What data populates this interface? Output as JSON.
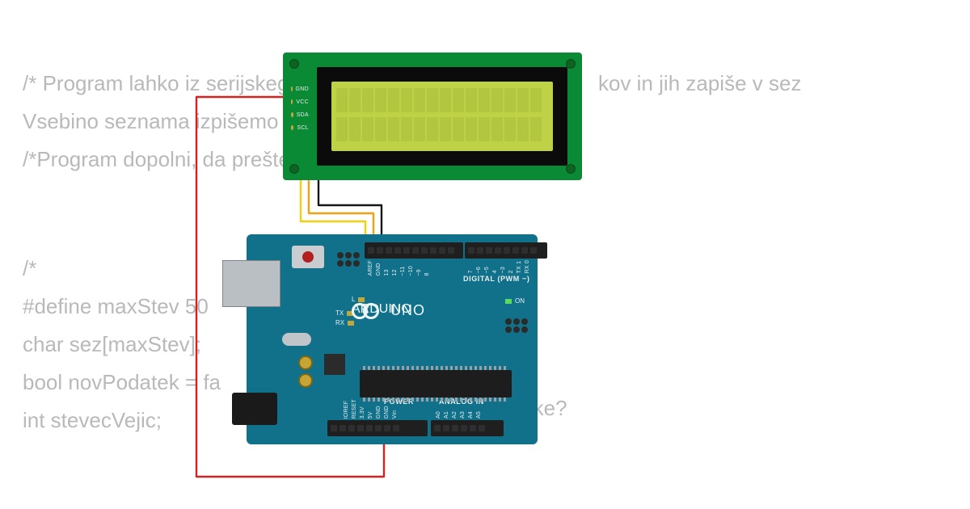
{
  "code_lines": [
    "/* Program lahko iz serijskega",
    "Vsebino seznama izpišemo na",
    "/*Program dopolni, da preštej",
    "",
    "",
    "/*",
    "#define maxStev 50",
    "char sez[maxStev];",
    "bool novPodatek = fa",
    "int stevecVejic;"
  ],
  "code_tail1": "kov in jih zapiše v sez",
  "code_tail2": "vse znake?",
  "lcd": {
    "pins": [
      "GND",
      "VCC",
      "SDA",
      "SCL"
    ]
  },
  "arduino": {
    "brand": "ARDUINO",
    "model": "UNO",
    "l_label": "L",
    "tx_label": "TX",
    "rx_label": "RX",
    "on_label": "ON",
    "section_digital": "DIGITAL (PWM ~)",
    "section_power": "POWER",
    "section_analog": "ANALOG IN",
    "pins_top_left": [
      "AREF",
      "GND",
      "13",
      "12",
      "~11",
      "~10",
      "~9",
      "8"
    ],
    "pins_top_right": [
      "7",
      "~6",
      "~5",
      "4",
      "~3",
      "2",
      "TX 1",
      "RX 0"
    ],
    "pins_power": [
      "IOREF",
      "RESET",
      "3.3V",
      "5V",
      "GND",
      "GND",
      "Vin"
    ],
    "pins_analog": [
      "A0",
      "A1",
      "A2",
      "A3",
      "A4",
      "A5"
    ]
  }
}
